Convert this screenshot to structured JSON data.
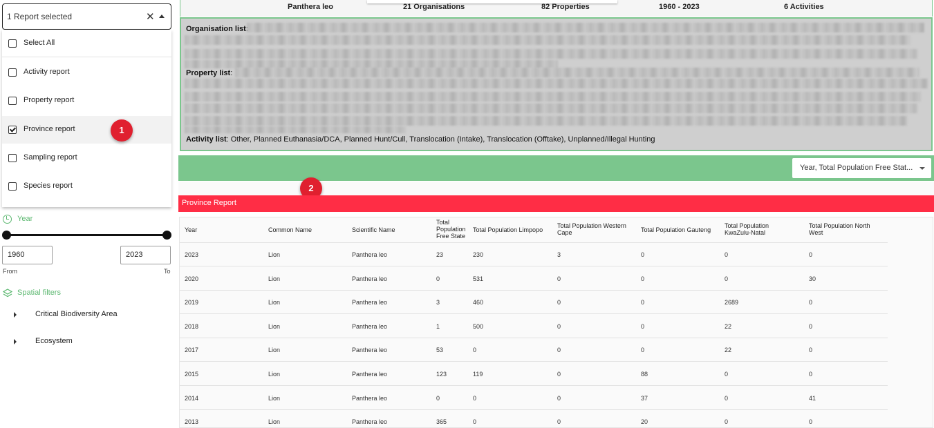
{
  "report_select": {
    "value": "1 Report selected",
    "clear_glyph": "✕"
  },
  "dropdown": {
    "select_all": "Select All",
    "items": [
      {
        "label": "Activity report",
        "checked": false
      },
      {
        "label": "Property report",
        "checked": false
      },
      {
        "label": "Province report",
        "checked": true
      },
      {
        "label": "Sampling report",
        "checked": false
      },
      {
        "label": "Species report",
        "checked": false
      }
    ]
  },
  "badges": {
    "one": "1",
    "two": "2"
  },
  "badge_color": "#e0202f",
  "filters": {
    "year_label": "Year",
    "year_from": "1960",
    "year_to": "2023",
    "from_caption": "From",
    "to_caption": "To",
    "spatial_label": "Spatial filters",
    "tree": [
      "Critical Biodiversity Area",
      "Ecosystem"
    ],
    "accent_color": "#5cb870"
  },
  "summary": {
    "species": "Panthera leo",
    "organisations": "21 Organisations",
    "properties": "82 Properties",
    "years": "1960 - 2023",
    "activities": "6 Activities"
  },
  "details": {
    "organisation_label": "Organisation list",
    "property_label": "Property list",
    "activity_label": "Activity list",
    "colon": ":",
    "activity_text": " Other, Planned Euthanasia/DCA, Planned Hunt/Cull, Translocation (Intake), Translocation (Offtake), Unplanned/Illegal Hunting"
  },
  "chart_selector": {
    "value": "Year, Total Population Free Stat..."
  },
  "section_title": "Province Report",
  "colors": {
    "green": "#7bc68d",
    "red": "#ff2d45"
  },
  "table": {
    "headers": [
      "Year",
      "Common Name",
      "Scientific Name",
      "Total Population Free State",
      "Total Population Limpopo",
      "Total Population Western Cape",
      "Total Population Gauteng",
      "Total Population KwaZulu-Natal",
      "Total Population North West"
    ],
    "rows": [
      [
        "2023",
        "Lion",
        "Panthera leo",
        "23",
        "230",
        "3",
        "0",
        "0",
        "0"
      ],
      [
        "2020",
        "Lion",
        "Panthera leo",
        "0",
        "531",
        "0",
        "0",
        "0",
        "30"
      ],
      [
        "2019",
        "Lion",
        "Panthera leo",
        "3",
        "460",
        "0",
        "0",
        "2689",
        "0"
      ],
      [
        "2018",
        "Lion",
        "Panthera leo",
        "1",
        "500",
        "0",
        "0",
        "22",
        "0"
      ],
      [
        "2017",
        "Lion",
        "Panthera leo",
        "53",
        "0",
        "0",
        "0",
        "22",
        "0"
      ],
      [
        "2015",
        "Lion",
        "Panthera leo",
        "123",
        "119",
        "0",
        "88",
        "0",
        "0"
      ],
      [
        "2014",
        "Lion",
        "Panthera leo",
        "0",
        "0",
        "0",
        "37",
        "0",
        "41"
      ],
      [
        "2013",
        "Lion",
        "Panthera leo",
        "365",
        "0",
        "0",
        "20",
        "0",
        "0"
      ]
    ]
  }
}
